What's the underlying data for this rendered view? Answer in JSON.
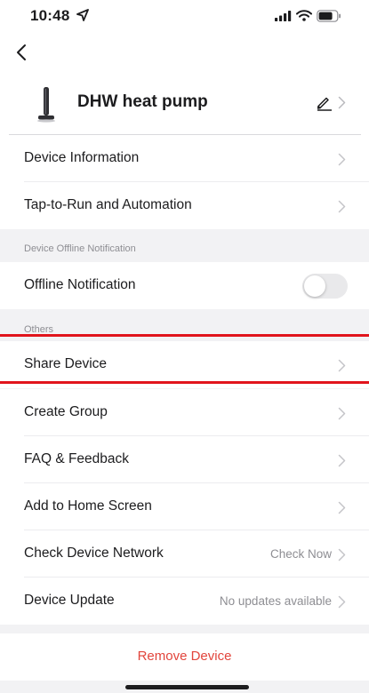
{
  "status_bar": {
    "time": "10:48"
  },
  "header": {
    "device_name": "DHW heat pump"
  },
  "rows": {
    "device_information": "Device Information",
    "tap_to_run": "Tap-to-Run and Automation",
    "offline_notification": "Offline Notification",
    "share_device": "Share Device",
    "create_group": "Create Group",
    "faq_feedback": "FAQ & Feedback",
    "add_to_home": "Add to Home Screen",
    "check_network": "Check Device Network",
    "check_network_value": "Check Now",
    "device_update": "Device Update",
    "device_update_value": "No updates available"
  },
  "sections": {
    "offline": "Device Offline Notification",
    "others": "Others"
  },
  "toggle": {
    "offline_notification_on": false
  },
  "actions": {
    "remove_device": "Remove Device"
  },
  "colors": {
    "highlight": "#e1141c",
    "destructive": "#e2453c",
    "background": "#f2f2f4"
  }
}
